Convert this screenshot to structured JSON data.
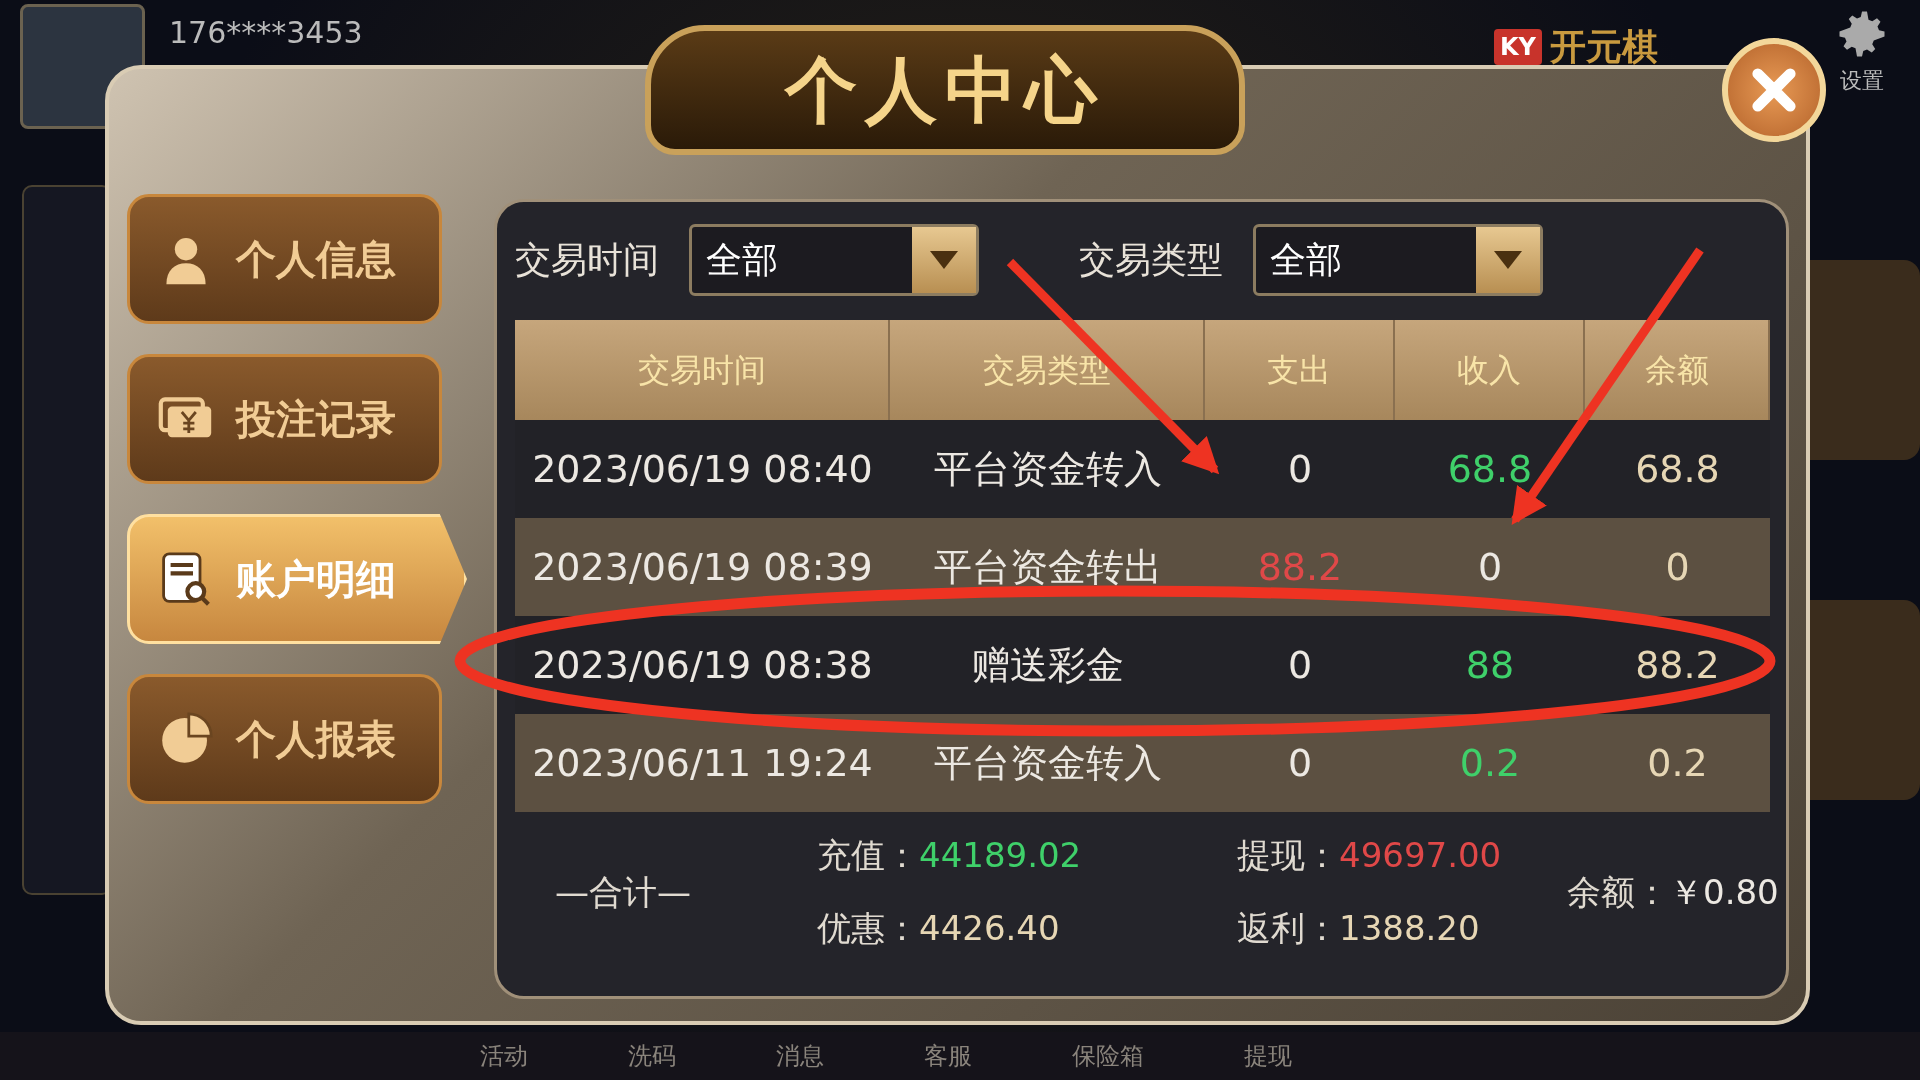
{
  "header": {
    "phone": "176****3453",
    "logo_badge": "KY",
    "logo": "开元棋",
    "settings_label": "设置"
  },
  "bottom_nav": [
    "活动",
    "洗码",
    "消息",
    "客服",
    "保险箱",
    "提现"
  ],
  "dialog": {
    "title": "个人中心"
  },
  "menu": [
    {
      "label": "个人信息",
      "kind": "person",
      "selected": false
    },
    {
      "label": "投注记录",
      "kind": "money",
      "selected": false
    },
    {
      "label": "账户明细",
      "kind": "document",
      "selected": true
    },
    {
      "label": "个人报表",
      "kind": "pie",
      "selected": false
    }
  ],
  "filters": [
    {
      "label": "交易时间",
      "value": "全部"
    },
    {
      "label": "交易类型",
      "value": "全部"
    }
  ],
  "table": {
    "columns": [
      "交易时间",
      "交易类型",
      "支出",
      "收入",
      "余额"
    ],
    "rows": [
      {
        "cells": [
          {
            "text": "2023/06/19 08:40",
            "kind": "plain"
          },
          {
            "text": "平台资金转入",
            "kind": "plain"
          },
          {
            "text": "0",
            "kind": "plain"
          },
          {
            "text": "68.8",
            "kind": "gain"
          },
          {
            "text": "68.8",
            "kind": "balance"
          }
        ]
      },
      {
        "cells": [
          {
            "text": "2023/06/19 08:39",
            "kind": "plain"
          },
          {
            "text": "平台资金转出",
            "kind": "plain"
          },
          {
            "text": "88.2",
            "kind": "loss"
          },
          {
            "text": "0",
            "kind": "plain"
          },
          {
            "text": "0",
            "kind": "balance"
          }
        ]
      },
      {
        "cells": [
          {
            "text": "2023/06/19 08:38",
            "kind": "plain"
          },
          {
            "text": "赠送彩金",
            "kind": "plain"
          },
          {
            "text": "0",
            "kind": "plain"
          },
          {
            "text": "88",
            "kind": "gain"
          },
          {
            "text": "88.2",
            "kind": "balance"
          }
        ]
      },
      {
        "cells": [
          {
            "text": "2023/06/11 19:24",
            "kind": "plain"
          },
          {
            "text": "平台资金转入",
            "kind": "plain"
          },
          {
            "text": "0",
            "kind": "plain"
          },
          {
            "text": "0.2",
            "kind": "gain"
          },
          {
            "text": "0.2",
            "kind": "balance"
          }
        ]
      }
    ]
  },
  "summary": {
    "total_label": "—合计—",
    "items": [
      {
        "label": "充值：",
        "value": "44189.02",
        "kind": "gain"
      },
      {
        "label": "提现：",
        "value": "49697.00",
        "kind": "loss"
      },
      {
        "label": "优惠：",
        "value": "4426.40",
        "kind": "balance"
      },
      {
        "label": "返利：",
        "value": "1388.20",
        "kind": "balance"
      }
    ],
    "balance": {
      "label": "余额：",
      "value": "￥0.80",
      "kind": "plain"
    }
  }
}
